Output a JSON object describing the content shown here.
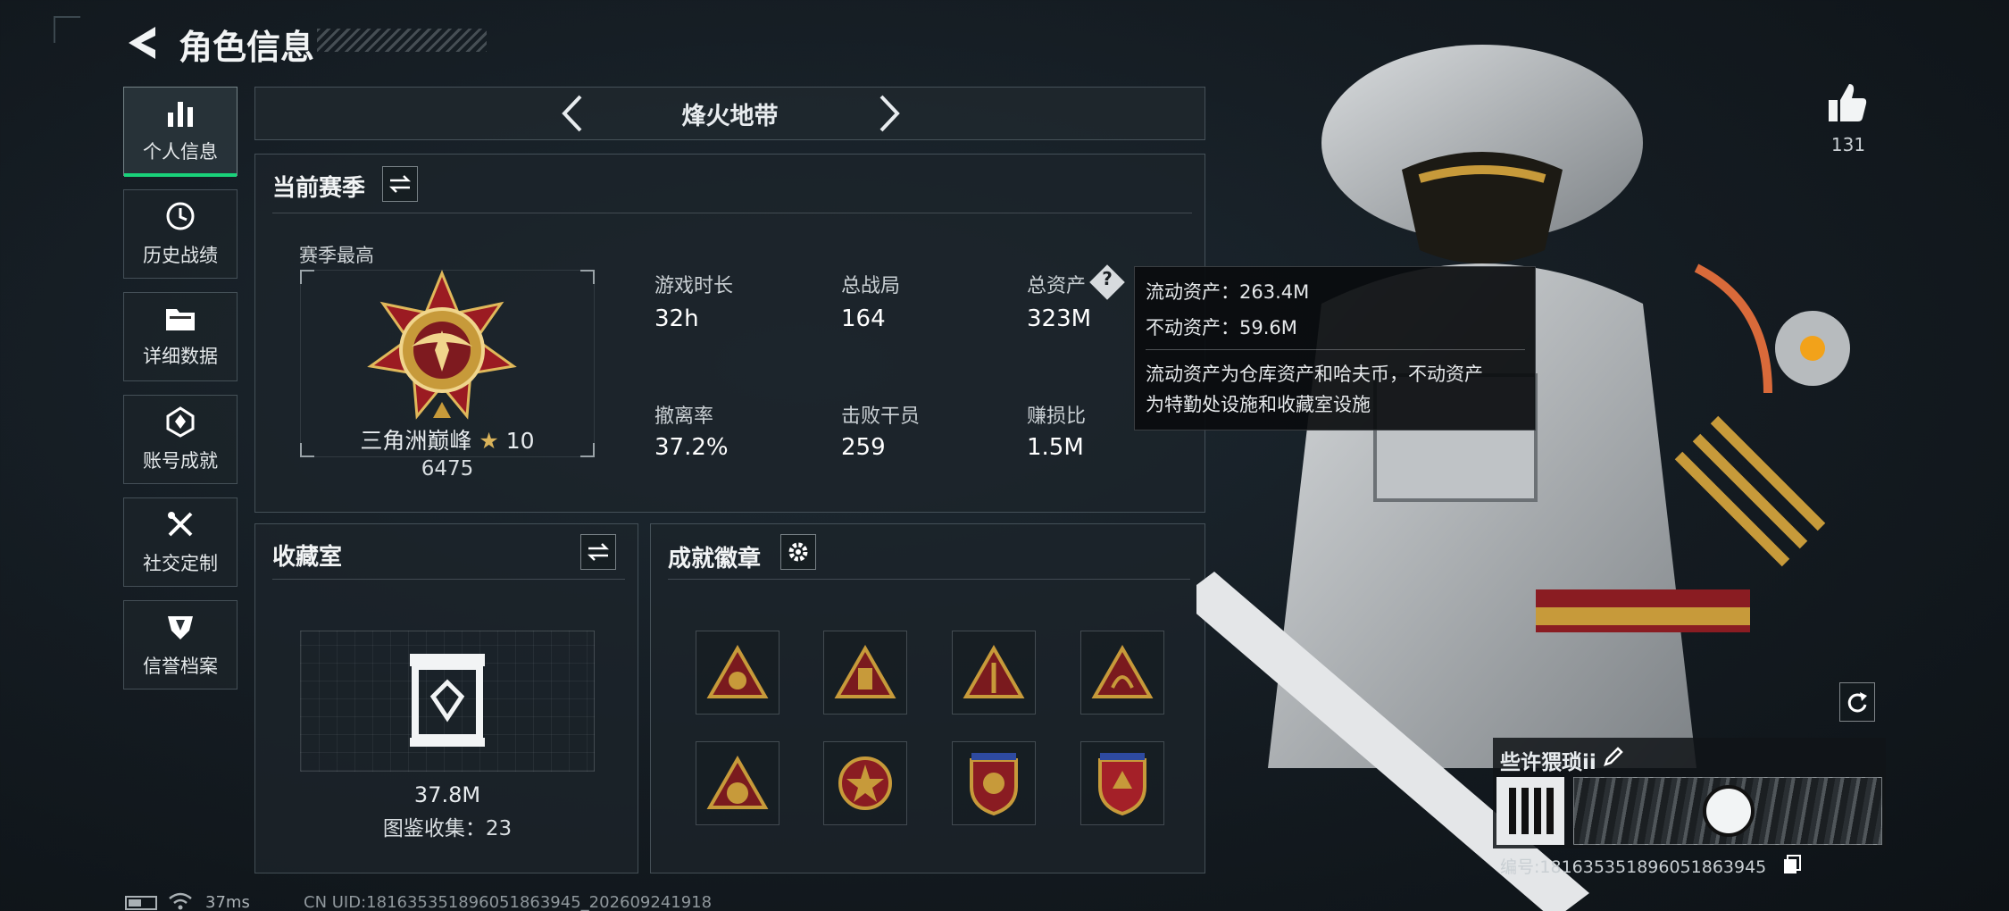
{
  "header": {
    "title": "角色信息"
  },
  "sidebar": {
    "items": [
      {
        "label": "个人信息",
        "icon": "bar-chart-icon",
        "active": true
      },
      {
        "label": "历史战绩",
        "icon": "history-clock-icon"
      },
      {
        "label": "详细数据",
        "icon": "folder-icon"
      },
      {
        "label": "账号成就",
        "icon": "achievement-icon"
      },
      {
        "label": "社交定制",
        "icon": "tools-icon"
      },
      {
        "label": "信誉档案",
        "icon": "shield-icon"
      }
    ]
  },
  "mode_selector": {
    "label": "烽火地带"
  },
  "season": {
    "title": "当前赛季",
    "best_label": "赛季最高",
    "rank_name": "三角洲巅峰",
    "rank_stars": "10",
    "rank_score": "6475",
    "stats": [
      {
        "label": "游戏时长",
        "value": "32h"
      },
      {
        "label": "总战局",
        "value": "164"
      },
      {
        "label": "总资产",
        "value": "323M"
      },
      {
        "label": "撤离率",
        "value": "37.2%"
      },
      {
        "label": "击败干员",
        "value": "259"
      },
      {
        "label": "赚损比",
        "value": "1.5M"
      }
    ]
  },
  "tooltip": {
    "line1": "流动资产：263.4M",
    "line2": "不动资产：59.6M",
    "desc1": "流动资产为仓库资产和哈夫币，不动资产",
    "desc2": "为特勤处设施和收藏室设施"
  },
  "collection": {
    "title": "收藏室",
    "value": "37.8M",
    "count_text": "图鉴收集：23"
  },
  "achievements": {
    "title": "成就徽章",
    "badges": [
      "badge-1",
      "badge-2",
      "badge-3",
      "badge-4",
      "badge-5",
      "badge-6",
      "badge-7",
      "badge-8"
    ]
  },
  "right": {
    "likes": "131",
    "player_name": "些许猥琐ii",
    "player_id": "编号:1816353518960518​63945"
  },
  "status_bar": {
    "ping": "37ms",
    "uid": "CN UID:1816353518960518​63945_202609241918"
  },
  "colors": {
    "accent_green": "#19d27a",
    "gold": "#c79a3a",
    "red": "#9b1b22"
  }
}
